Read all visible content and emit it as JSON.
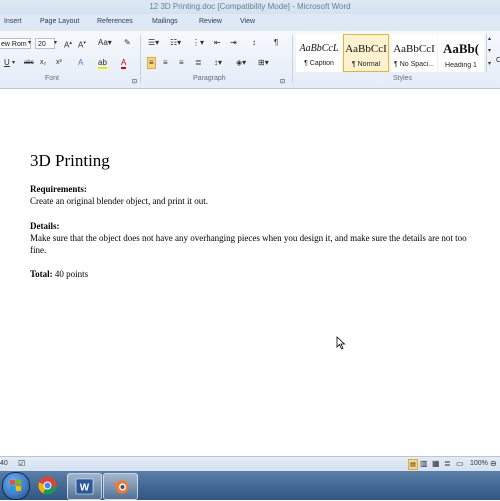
{
  "window": {
    "title": "12 3D Printing.doc [Compatibility Mode] - Microsoft Word"
  },
  "tabs": [
    "Insert",
    "Page Layout",
    "References",
    "Mailings",
    "Review",
    "View"
  ],
  "ribbon": {
    "font": {
      "name": "ew Rom",
      "size": "20",
      "label": "Font"
    },
    "paragraph": {
      "label": "Paragraph"
    },
    "styles": {
      "label": "Styles",
      "tiles": [
        {
          "preview": "AaBbCcL",
          "name": "¶ Caption"
        },
        {
          "preview": "AaBbCcI",
          "name": "¶ Normal"
        },
        {
          "preview": "AaBbCcI",
          "name": "¶ No Spaci..."
        },
        {
          "preview": "AaBb(",
          "name": "Heading 1"
        }
      ],
      "more_glyph": "C"
    }
  },
  "document": {
    "title": "3D Printing",
    "requirements_label": "Requirements:",
    "requirements_text": "Create an original  blender object, and print it out.",
    "details_label": "Details:",
    "details_text": "Make sure that the object does not have any overhanging pieces when you design it, and make sure the details are not too fine.",
    "total_label": "Total:",
    "total_value": " 40 points"
  },
  "statusbar": {
    "left": "40",
    "zoom": "100%"
  },
  "colors": {
    "ribbon_bg": "#e4ecf7",
    "taskbar": "#3a6391",
    "style_selected": "#fdf2cf"
  }
}
